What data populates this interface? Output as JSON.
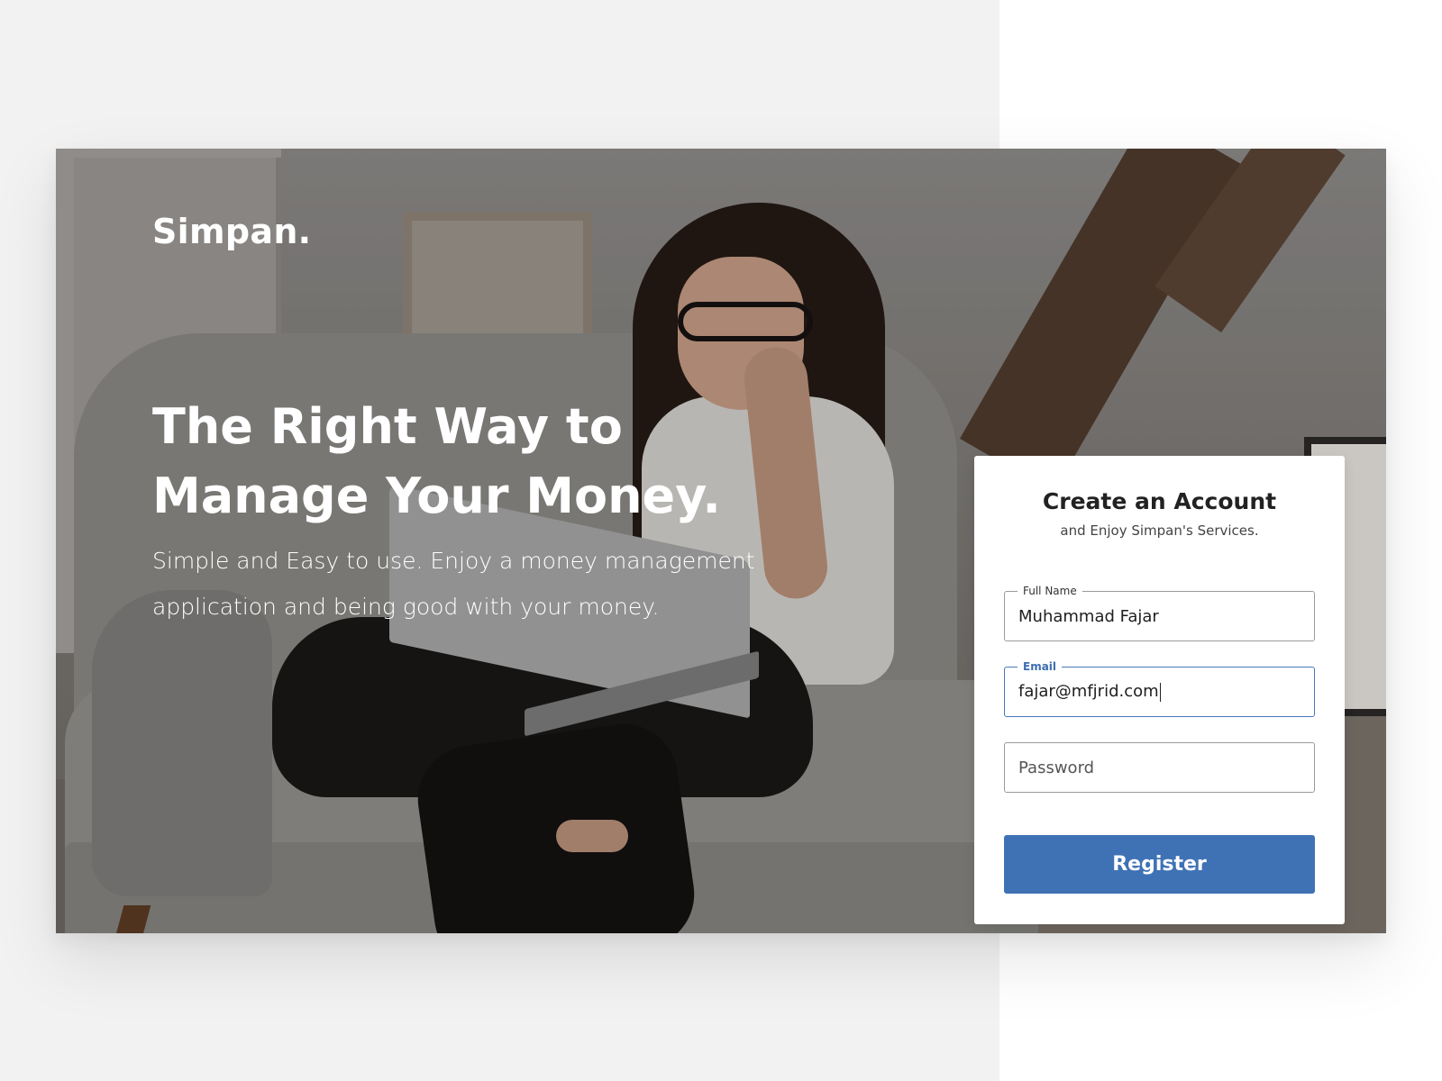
{
  "brand": {
    "logo": "Simpan."
  },
  "hero": {
    "headline": "The Right Way to Manage Your Money.",
    "subline": "Simple and Easy to use. Enjoy a money management application and being good with your money."
  },
  "register_form": {
    "title": "Create an Account",
    "subtitle": "and Enjoy Simpan's Services.",
    "full_name": {
      "label": "Full Name",
      "value": "Muhammad Fajar"
    },
    "email": {
      "label": "Email",
      "value": "fajar@mfjrid.com",
      "focused": true
    },
    "password": {
      "placeholder": "Password",
      "value": ""
    },
    "submit_label": "Register"
  },
  "colors": {
    "accent": "#3f72b5",
    "focus_border": "#4a78b8",
    "page_left_bg": "#f2f2f2",
    "page_right_bg": "#ffffff"
  },
  "background_image": {
    "subject": "woman-on-sofa-with-laptop"
  }
}
